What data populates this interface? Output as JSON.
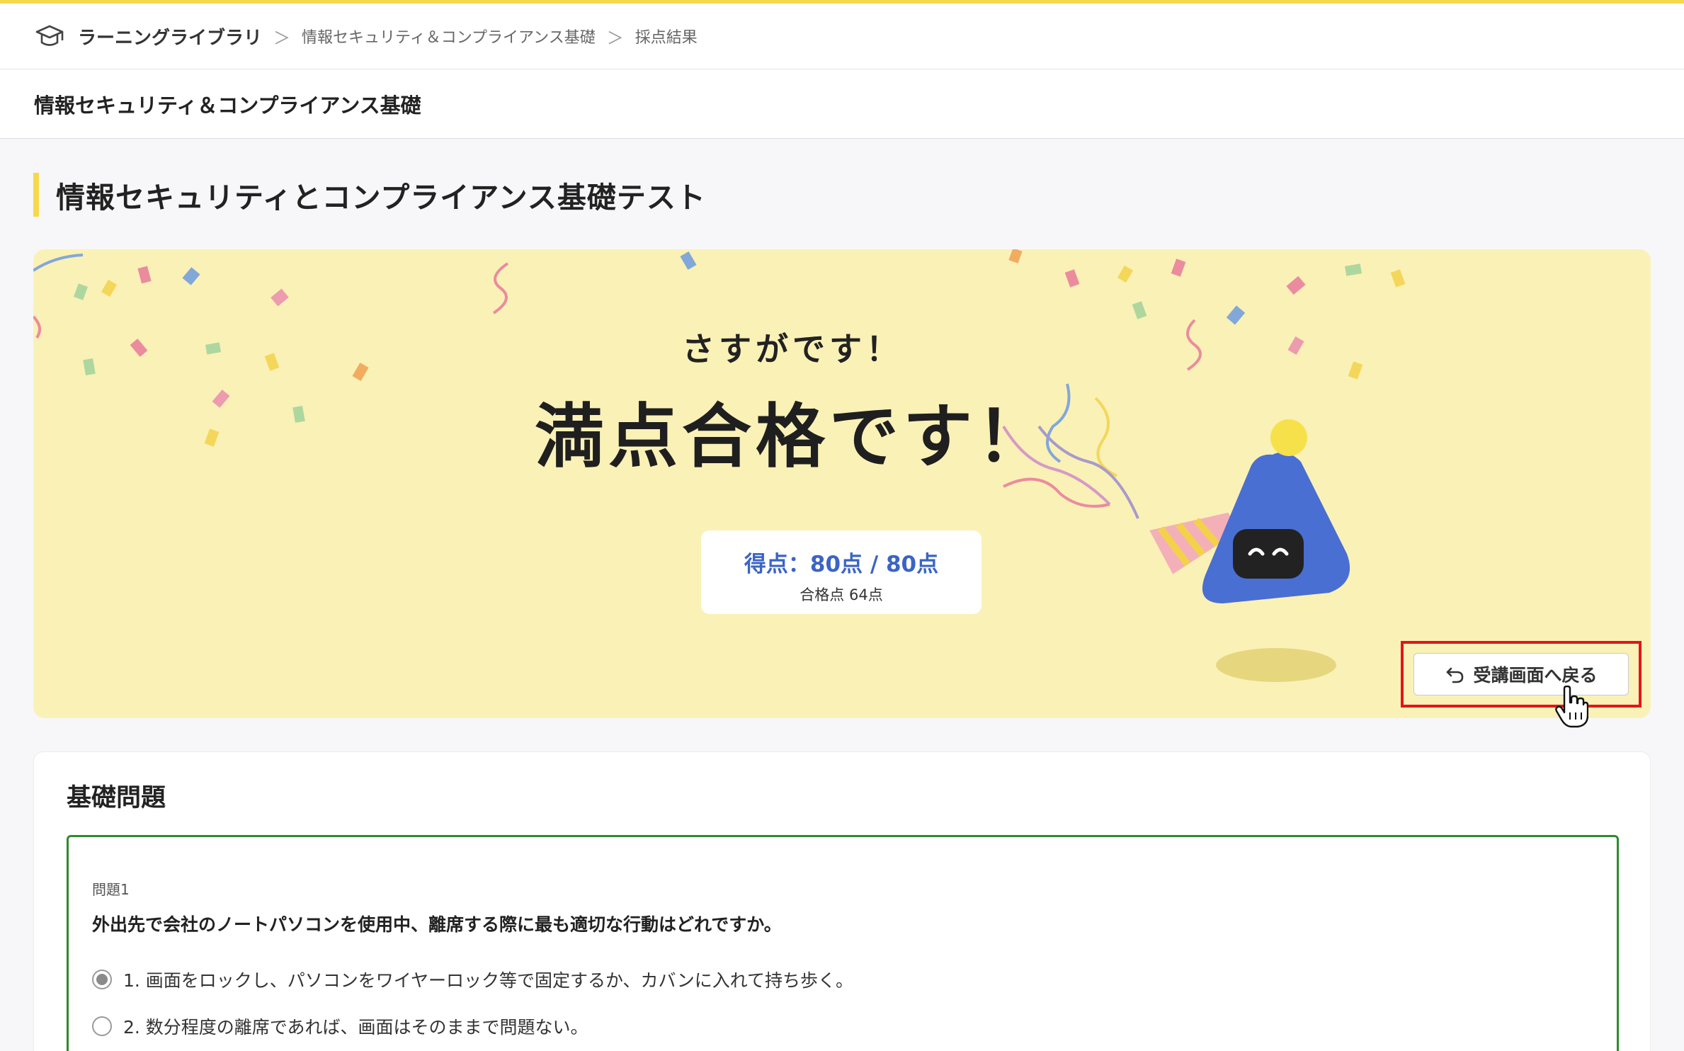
{
  "breadcrumb": {
    "root": "ラーニングライブラリ",
    "course": "情報セキュリティ＆コンプライアンス基礎",
    "current": "採点結果",
    "separator": "＞"
  },
  "course_title": "情報セキュリティ＆コンプライアンス基礎",
  "test_title": "情報セキュリティとコンプライアンス基礎テスト",
  "result": {
    "praise": "さすがです！",
    "headline": "満点合格です！",
    "score_label": "得点：80点 / 80点",
    "passing_label": "合格点 64点",
    "score": 80,
    "max_score": 80,
    "passing_score": 64
  },
  "back_button": {
    "label": "受講画面へ戻る"
  },
  "section": {
    "title": "基礎問題",
    "questions": [
      {
        "number_label": "問題1",
        "text": "外出先で会社のノートパソコンを使用中、離席する際に最も適切な行動はどれですか。",
        "options": [
          {
            "label": "1. 画面をロックし、パソコンをワイヤーロック等で固定するか、カバンに入れて持ち歩く。",
            "selected": true
          },
          {
            "label": "2. 数分程度の離席であれば、画面はそのままで問題ない。",
            "selected": false
          }
        ]
      }
    ]
  },
  "colors": {
    "accent": "#f5d94a",
    "banner": "#faf1b7",
    "score_text": "#3b64c4",
    "correct_border": "#2e8b2e",
    "highlight": "#e3151b",
    "mascot": "#4a6fd2"
  },
  "icons": {
    "logo": "graduation-cap-icon",
    "back": "return-arrow-icon",
    "cursor": "hand-pointer-icon"
  }
}
